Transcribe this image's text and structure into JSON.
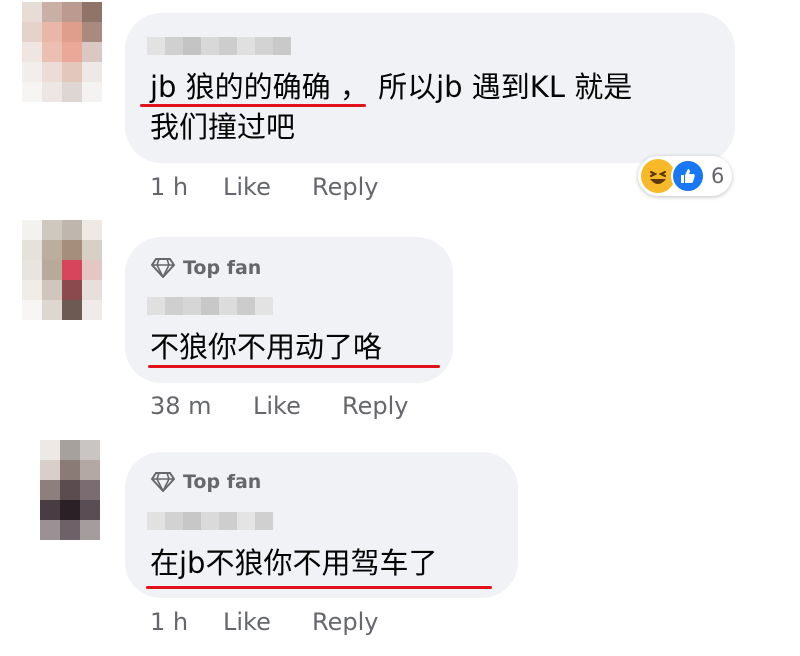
{
  "comments": [
    {
      "top_fan": "",
      "text_lines": [
        "jb 狼的的确确 ，  所以jb 遇到KL 就是",
        "我们撞过吧"
      ],
      "time": "1 h",
      "like_label": "Like",
      "reply_label": "Reply",
      "reactions": {
        "types": [
          "haha-icon",
          "like-icon"
        ],
        "count": "6"
      }
    },
    {
      "top_fan": "Top fan",
      "text_lines": [
        "不狼你不用动了咯"
      ],
      "time": "38 m",
      "like_label": "Like",
      "reply_label": "Reply"
    },
    {
      "top_fan": "Top fan",
      "text_lines": [
        "在jb不狼你不用驾车了"
      ],
      "time": "1 h",
      "like_label": "Like",
      "reply_label": "Reply"
    }
  ],
  "colors": {
    "bubble": "#f0f2f5",
    "underline": "#e1121a",
    "meta_text": "#65676b",
    "like_blue": "#1877f2",
    "haha_yellow": "#f7b928"
  }
}
